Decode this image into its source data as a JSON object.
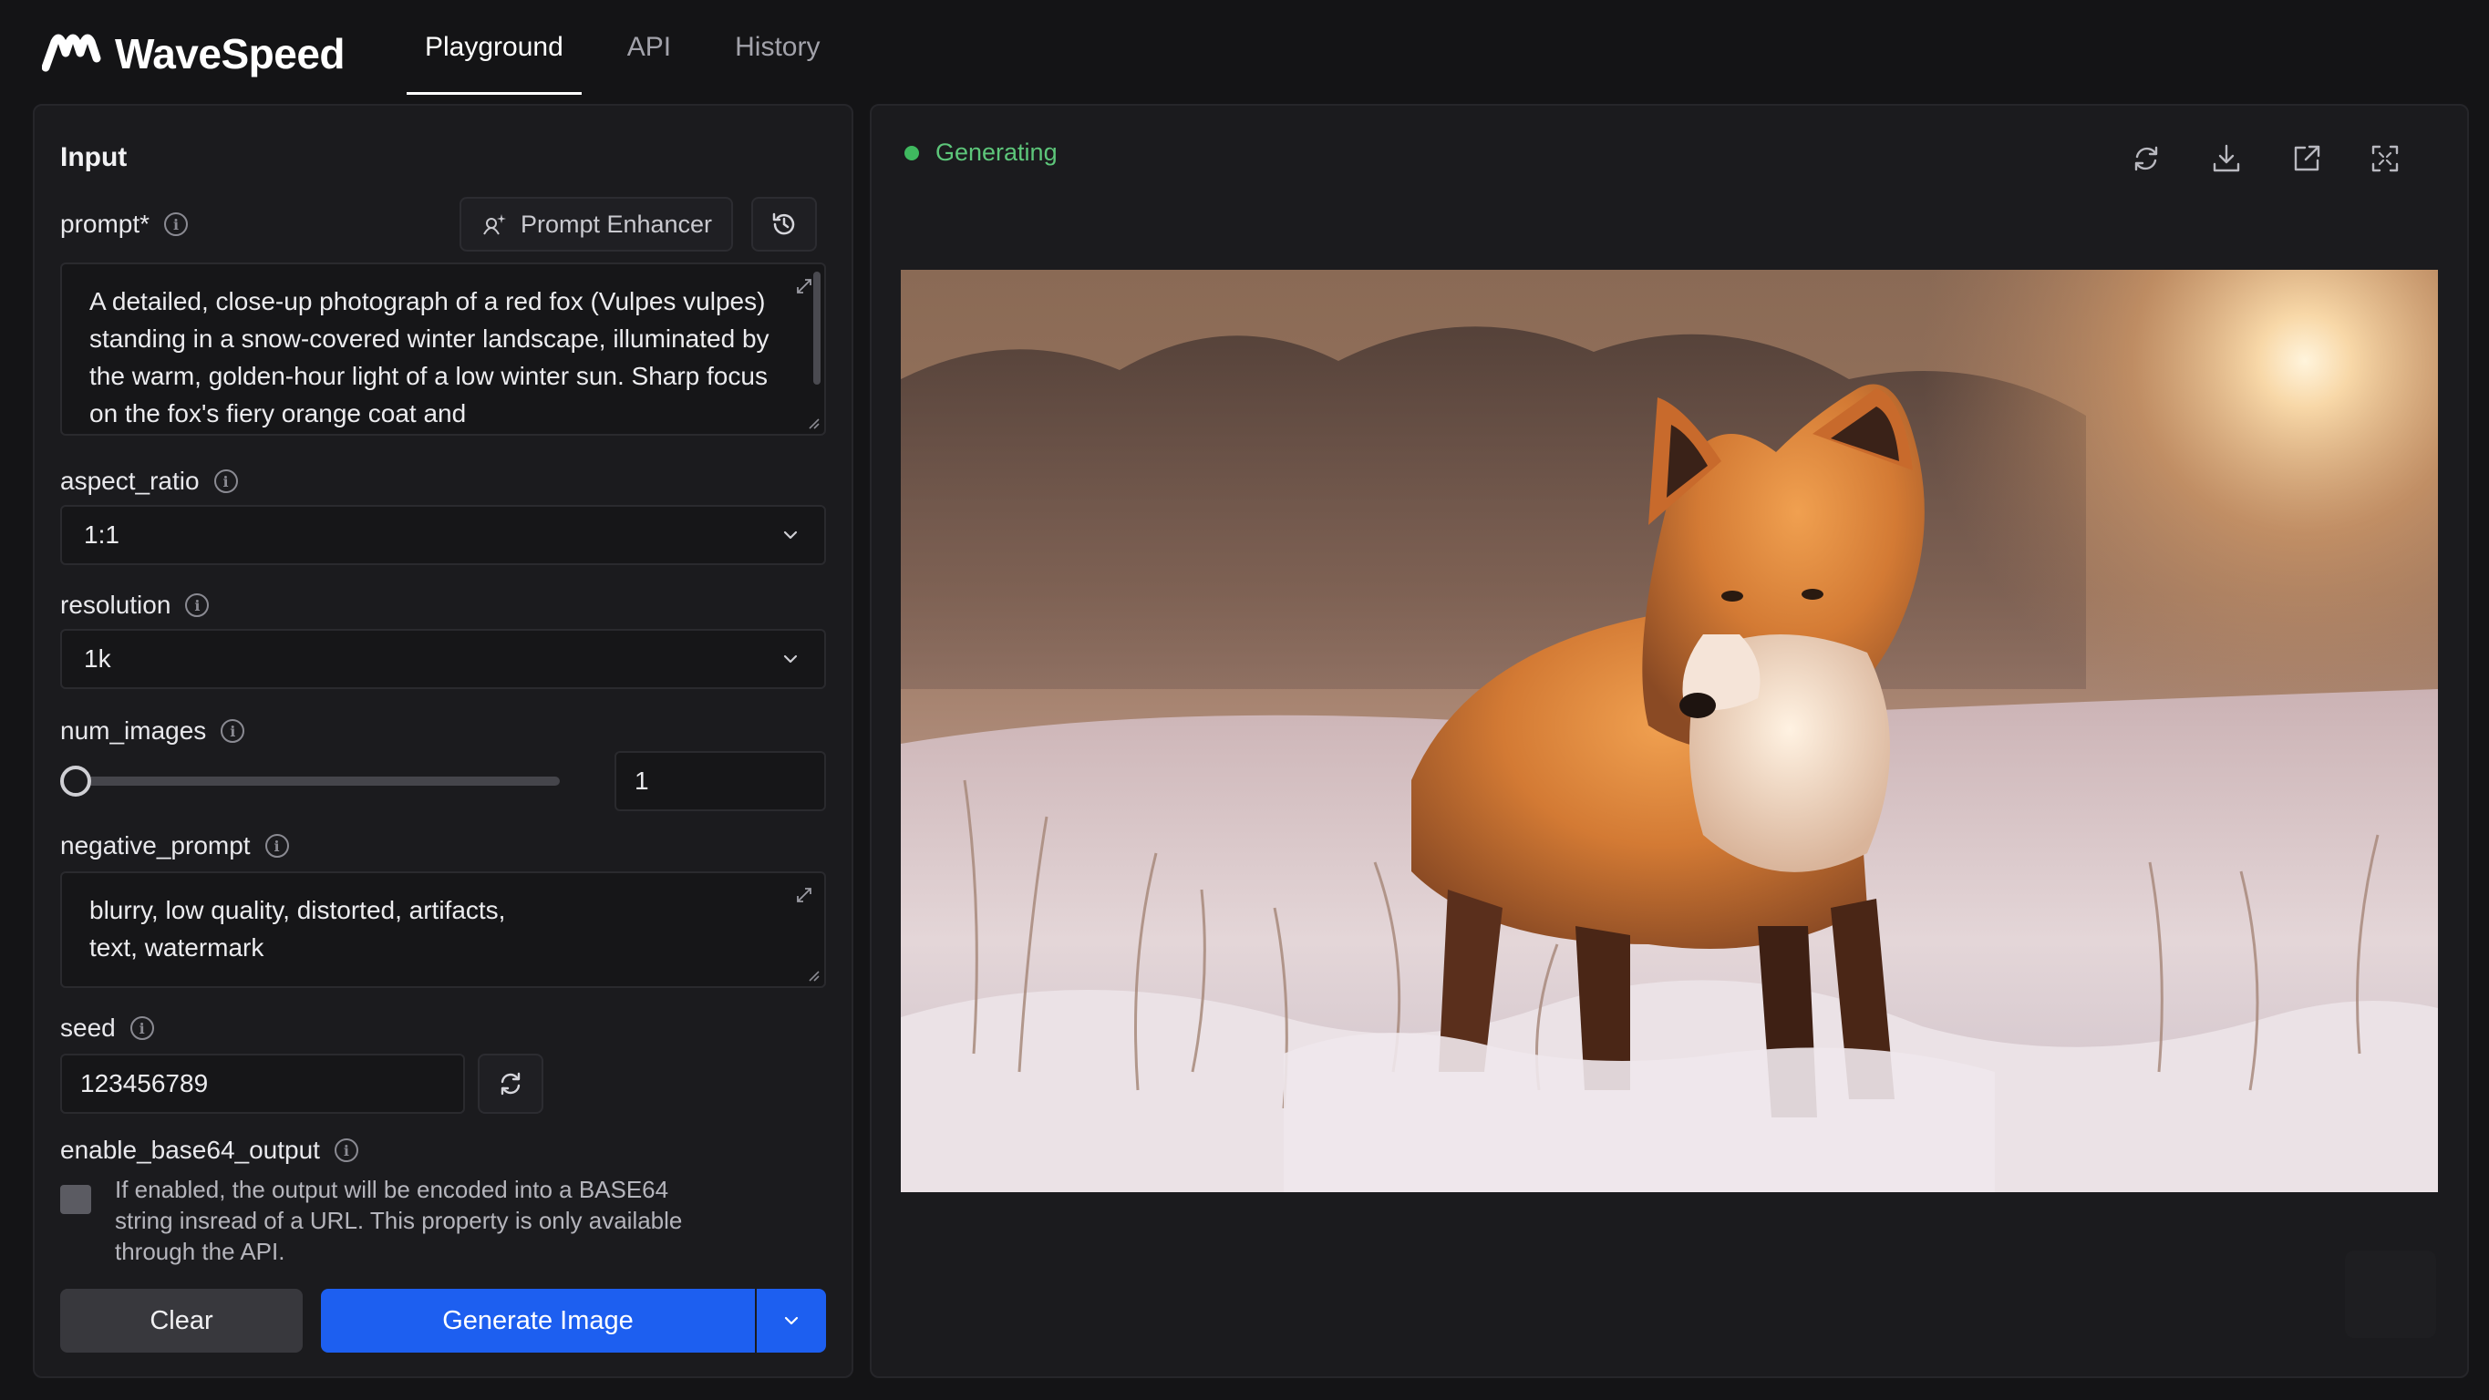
{
  "brand": {
    "name": "WaveSpeed"
  },
  "nav": {
    "tabs": [
      {
        "label": "Playground",
        "active": true
      },
      {
        "label": "API",
        "active": false
      },
      {
        "label": "History",
        "active": false
      }
    ]
  },
  "input_panel": {
    "title": "Input",
    "prompt": {
      "label": "prompt*",
      "enhancer_label": "Prompt Enhancer",
      "value": "A detailed, close-up photograph of a red fox (Vulpes vulpes) standing in a snow-covered winter landscape, illuminated by the warm, golden-hour light of a low winter sun. Sharp focus on the fox's fiery orange coat and"
    },
    "aspect_ratio": {
      "label": "aspect_ratio",
      "value": "1:1"
    },
    "resolution": {
      "label": "resolution",
      "value": "1k"
    },
    "num_images": {
      "label": "num_images",
      "value": "1",
      "slider_fraction": 0.0
    },
    "negative_prompt": {
      "label": "negative_prompt",
      "value": "blurry, low quality, distorted, artifacts, text, watermark"
    },
    "seed": {
      "label": "seed",
      "value": "123456789"
    },
    "enable_base64_output": {
      "label": "enable_base64_output",
      "checked": false,
      "help": "If enabled, the output will be encoded into a BASE64 string insread of a URL. This property is only available through the API."
    },
    "buttons": {
      "clear": "Clear",
      "generate": "Generate Image"
    }
  },
  "output_panel": {
    "status": "Generating",
    "status_color": "#3fb95f",
    "toolbar_icons": [
      "refresh-icon",
      "download-icon",
      "open-external-icon",
      "fullscreen-icon"
    ],
    "image_subject": "red-fox-in-snow-photo"
  },
  "colors": {
    "background": "#141416",
    "panel": "#1b1b1e",
    "primary": "#1d5ff0",
    "accent_status": "#3fb95f"
  }
}
